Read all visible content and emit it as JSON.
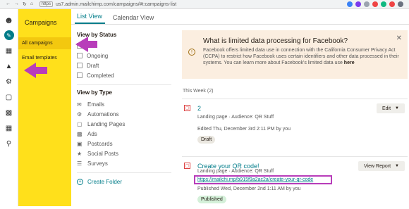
{
  "browser": {
    "https": "https",
    "url": "us7.admin.mailchimp.com/campaigns/#t:campaigns-list"
  },
  "rail": {
    "icons": [
      "mailchimp-logo-icon",
      "create-pencil-icon",
      "audience-icon",
      "campaigns-megaphone-icon",
      "automations-icon",
      "landing-pages-icon",
      "content-icon",
      "integrations-icon",
      "search-icon"
    ]
  },
  "sidebar": {
    "title": "Campaigns",
    "items": [
      {
        "label": "All campaigns",
        "active": true
      },
      {
        "label": "Email templates",
        "active": false
      }
    ]
  },
  "tabs": [
    {
      "label": "List View",
      "active": true
    },
    {
      "label": "Calendar View",
      "active": false
    }
  ],
  "filters": {
    "status_title": "View by Status",
    "status_options": [
      "All",
      "Ongoing",
      "Draft",
      "Completed"
    ],
    "type_title": "View by Type",
    "type_options": [
      "Emails",
      "Automations",
      "Landing Pages",
      "Ads",
      "Postcards",
      "Social Posts",
      "Surveys"
    ],
    "create_folder": "Create Folder"
  },
  "notice": {
    "title": "What is limited data processing for Facebook?",
    "body": "Facebook offers limited data use in connection with the California Consumer Privacy Act (CCPA) to restrict how Facebook uses certain identifiers and other data processed in their systems. You can learn more about Facebook's limited data use",
    "link": "here"
  },
  "week_label": "This Week (2)",
  "campaigns": [
    {
      "name": "2",
      "type_line": "Landing page · Audience: QR Stuff",
      "date_line": "Edited Thu, December 3rd 2:11 PM by you",
      "status": "Draft",
      "action": "Edit"
    },
    {
      "name": "Create your QR code!",
      "type_line": "Landing page · Audience: QR Stuff",
      "url": "https://mailchi.mp/b915f9a2ac2a/create-your-qr-code",
      "date_line": "Published Wed, December 2nd 1:11 AM by you",
      "status": "Published",
      "action": "View Report"
    }
  ],
  "colors": {
    "sidebar_yellow": "#ffe01b",
    "teal": "#007c89",
    "annotation_purple": "#b83dba"
  }
}
